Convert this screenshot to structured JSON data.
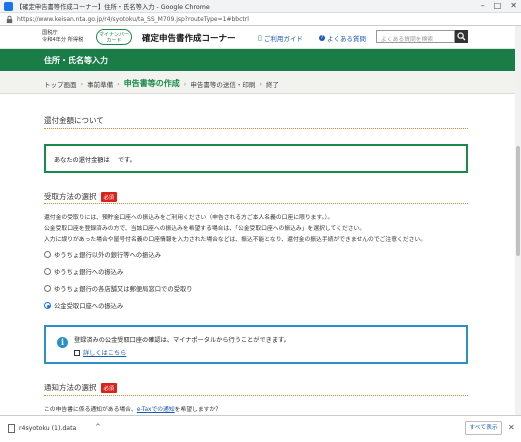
{
  "window": {
    "title": "【確定申告書等作成コーナー】住所・氏名等入力 - Google Chrome",
    "minimize": "–",
    "maximize": "□",
    "close": "✕"
  },
  "address_bar": {
    "url": "https://www.keisan.nta.go.jp/r4/syotoku/ta_SS_M709.jsp?routeType=1#bbctrl"
  },
  "site_header": {
    "agency": "国税庁\n令和4年分 所得税",
    "mynumber_badge": "マイナンバー\nカード",
    "site_title": "確定申告書作成コーナー",
    "guide_link": "ご利用ガイド",
    "faq_link": "よくある質問",
    "search_placeholder": "よくある質問を検索"
  },
  "page": {
    "title": "住所・氏名等入力"
  },
  "breadcrumb": {
    "items": [
      "トップ画面",
      "事前準備",
      "申告書等の作成",
      "申告書等の送信・印刷",
      "終了"
    ],
    "separator": "›"
  },
  "refund": {
    "heading": "還付金額について",
    "message": "あなたの還付金額は 　です。"
  },
  "receipt_method": {
    "heading": "受取方法の選択",
    "required": "必須",
    "para1": "還付金の受取りには、預貯金口座への振込みをご利用ください（申告される方ご本人名義の口座に限ります。）。",
    "para2": "公金受取口座を登録済みの方で、当該口座への振込みを希望する場合は、「公金受取口座への振込み」を選択してください。",
    "para3": "入力に誤りがあった場合や屋号付名義の口座情報を入力された場合などは、振込不能となり、還付金の振込手続ができませんのでご注意ください。",
    "options": [
      "ゆうちょ銀行以外の銀行等への振込み",
      "ゆうちょ銀行への振込み",
      "ゆうちょ銀行の各店舗又は郵便局窓口での受取り",
      "公金受取口座への振込み"
    ],
    "selected_index": 3
  },
  "info_box": {
    "message": "登録済みの公金受取口座の確認は、マイナポータルから行うことができます。",
    "link": "詳しくはこちら"
  },
  "notice": {
    "heading": "通知方法の選択",
    "required": "必須",
    "text_prefix": "この申告書に係る通知がある場合、",
    "link": "e-Taxでの通知",
    "text_suffix": "を希望しますか？"
  },
  "download_bar": {
    "filename": "r4syotoku (1).data",
    "chevron": "^",
    "show_all": "すべて表示",
    "close": "✕"
  },
  "colors": {
    "brand_green": "#1a7d48",
    "required_red": "#d9231c",
    "info_blue": "#2a90c8",
    "link_blue": "#1a5bb8"
  }
}
